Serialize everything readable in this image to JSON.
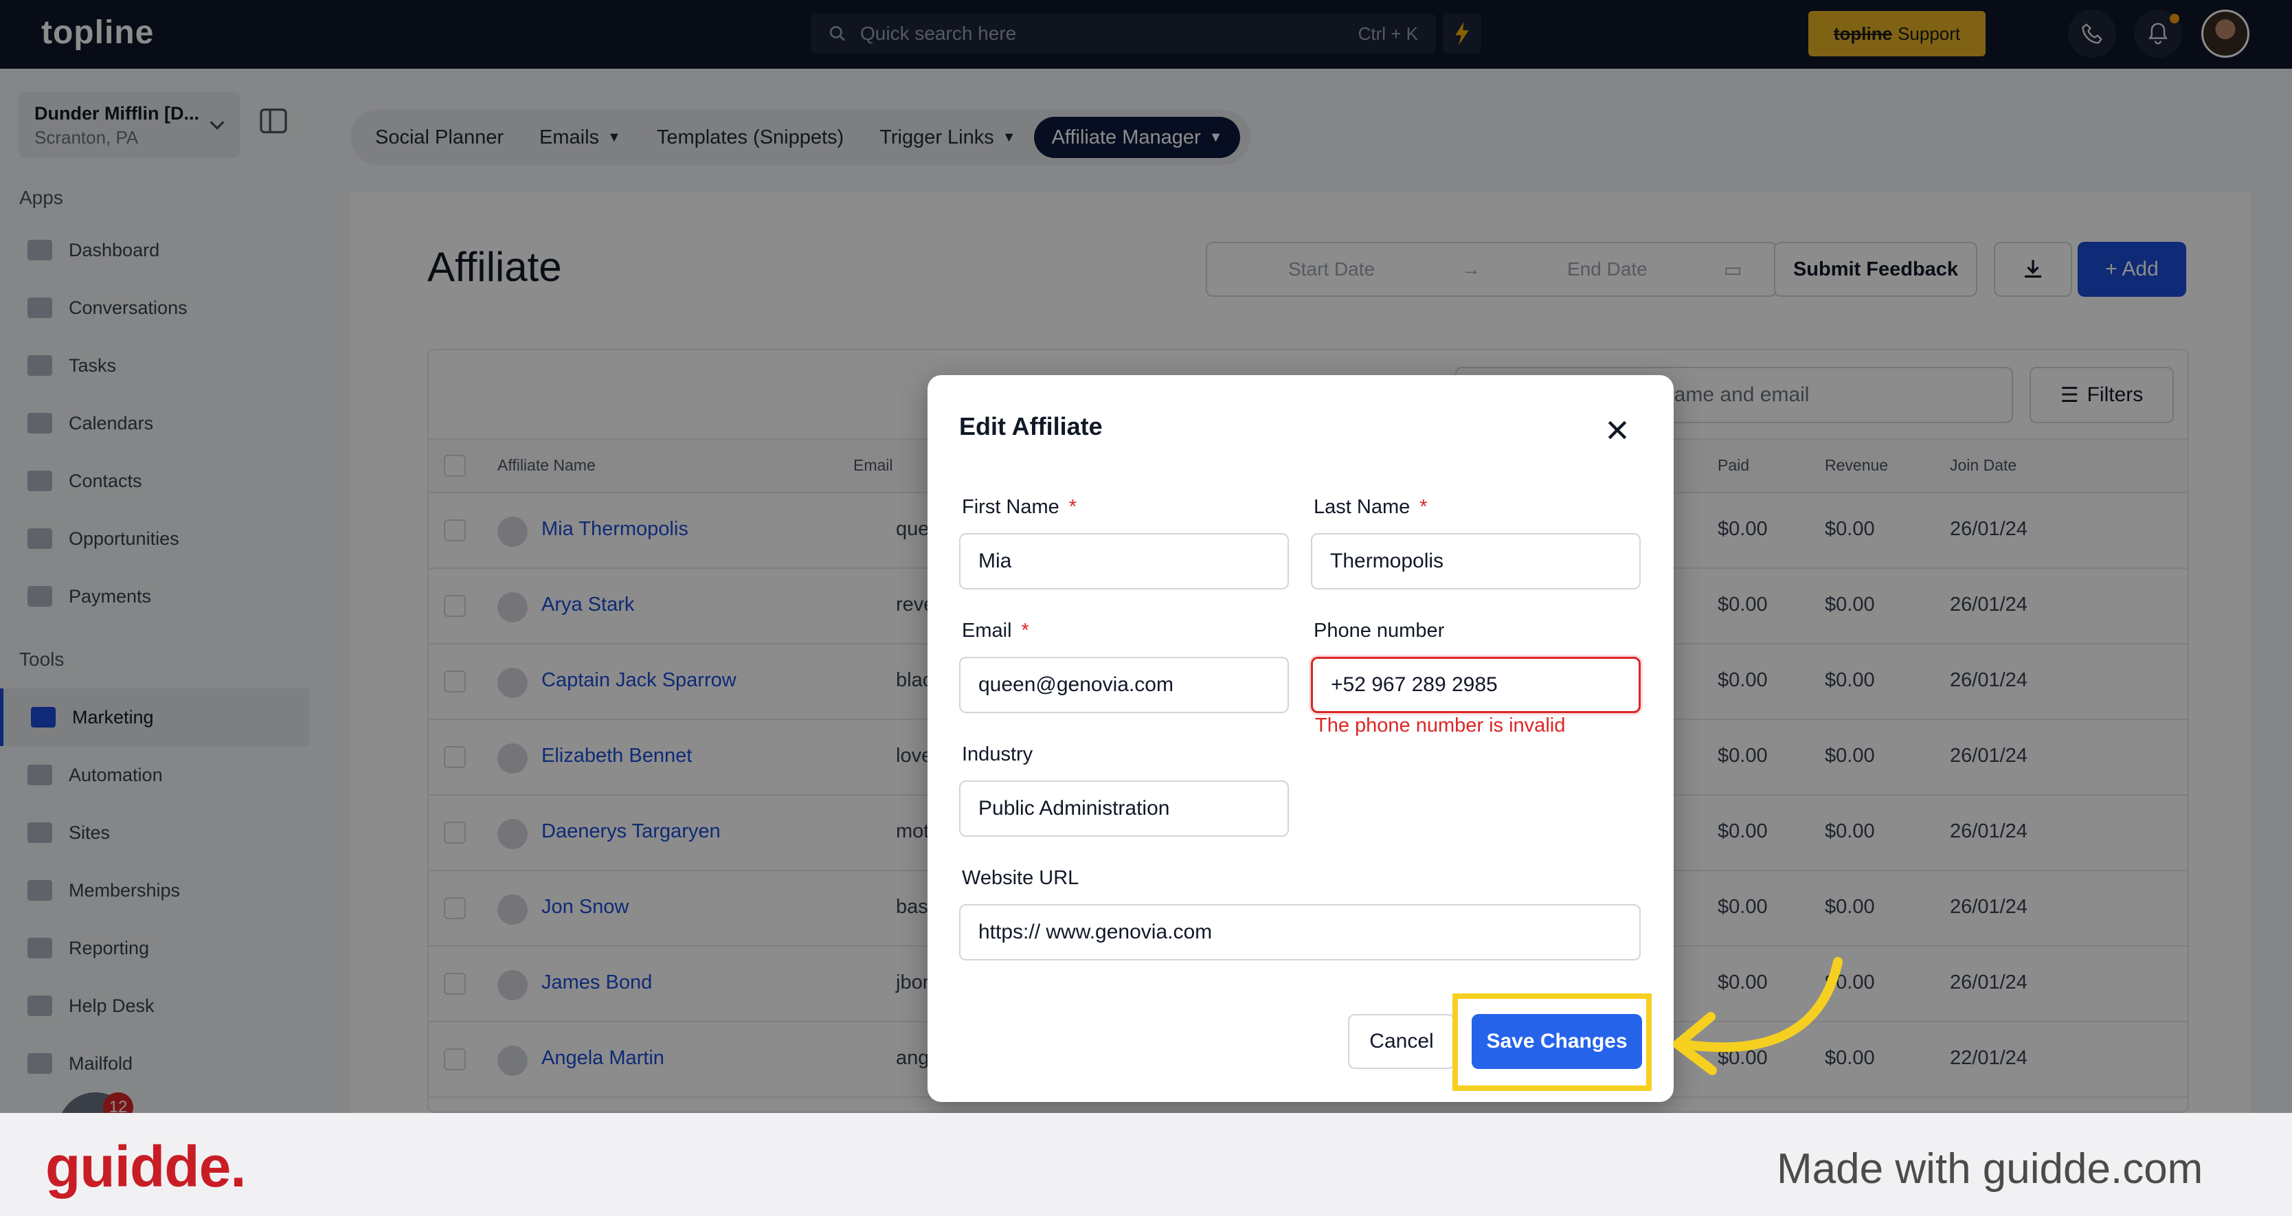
{
  "topbar": {
    "logo": "topline",
    "search_placeholder": "Quick search here",
    "search_shortcut": "Ctrl + K",
    "support_brand": "topline",
    "support_label": "Support"
  },
  "sidebar": {
    "location_name": "Dunder Mifflin [D...",
    "location_sub": "Scranton, PA",
    "apps_heading": "Apps",
    "tools_heading": "Tools",
    "apps": [
      "Dashboard",
      "Conversations",
      "Tasks",
      "Calendars",
      "Contacts",
      "Opportunities",
      "Payments"
    ],
    "tools": [
      "Marketing",
      "Automation",
      "Sites",
      "Memberships",
      "Reporting",
      "Help Desk",
      "Mailfold"
    ],
    "active_item": "Marketing",
    "badge_count": "12"
  },
  "tabs": [
    {
      "label": "Social Planner",
      "has_caret": false
    },
    {
      "label": "Emails",
      "has_caret": true
    },
    {
      "label": "Templates (Snippets)",
      "has_caret": false
    },
    {
      "label": "Trigger Links",
      "has_caret": true
    },
    {
      "label": "Affiliate Manager",
      "has_caret": true,
      "active": true
    }
  ],
  "page": {
    "title": "Affiliate",
    "start_date_placeholder": "Start Date",
    "end_date_placeholder": "End Date",
    "feedback_label": "Submit Feedback",
    "add_label": "+ Add"
  },
  "table": {
    "search_placeholder": "name and email",
    "filters_label": "Filters",
    "headers": {
      "name": "Affiliate Name",
      "email": "Email",
      "paid": "Paid",
      "revenue": "Revenue",
      "join": "Join Date"
    },
    "rows": [
      {
        "name": "Mia Thermopolis",
        "email": "queen@",
        "paid": "$0.00",
        "revenue": "$0.00",
        "join": "26/01/24"
      },
      {
        "name": "Arya Stark",
        "email": "revenge",
        "paid": "$0.00",
        "revenue": "$0.00",
        "join": "26/01/24"
      },
      {
        "name": "Captain Jack Sparrow",
        "email": "blackpe",
        "paid": "$0.00",
        "revenue": "$0.00",
        "join": "26/01/24"
      },
      {
        "name": "Elizabeth Bennet",
        "email": "lovedarc",
        "paid": "$0.00",
        "revenue": "$0.00",
        "join": "26/01/24"
      },
      {
        "name": "Daenerys Targaryen",
        "email": "motherc",
        "paid": "$0.00",
        "revenue": "$0.00",
        "join": "26/01/24"
      },
      {
        "name": "Jon Snow",
        "email": "bastardc",
        "paid": "$0.00",
        "revenue": "$0.00",
        "join": "26/01/24"
      },
      {
        "name": "James Bond",
        "email": "jbond@a",
        "paid": "$0.00",
        "revenue": "$0.00",
        "join": "26/01/24"
      },
      {
        "name": "Angela Martin",
        "email": "angela@",
        "paid": "$0.00",
        "revenue": "$0.00",
        "join": "22/01/24"
      }
    ]
  },
  "modal": {
    "title": "Edit Affiliate",
    "first_name_label": "First Name",
    "first_name_value": "Mia",
    "last_name_label": "Last Name",
    "last_name_value": "Thermopolis",
    "email_label": "Email",
    "email_value": "queen@genovia.com",
    "phone_label": "Phone number",
    "phone_value": "+52 967 289 2985",
    "phone_error": "The phone number is invalid",
    "industry_label": "Industry",
    "industry_value": "Public Administration",
    "website_label": "Website URL",
    "website_value": "https:// www.genovia.com",
    "required_mark": "*",
    "cancel_label": "Cancel",
    "save_label": "Save Changes"
  },
  "footer": {
    "logo": "guidde.",
    "tagline": "Made with guidde.com"
  },
  "colors": {
    "accent": "#2563eb",
    "highlight": "#f5d020",
    "error": "#dc2626",
    "topbar": "#0e1629"
  }
}
